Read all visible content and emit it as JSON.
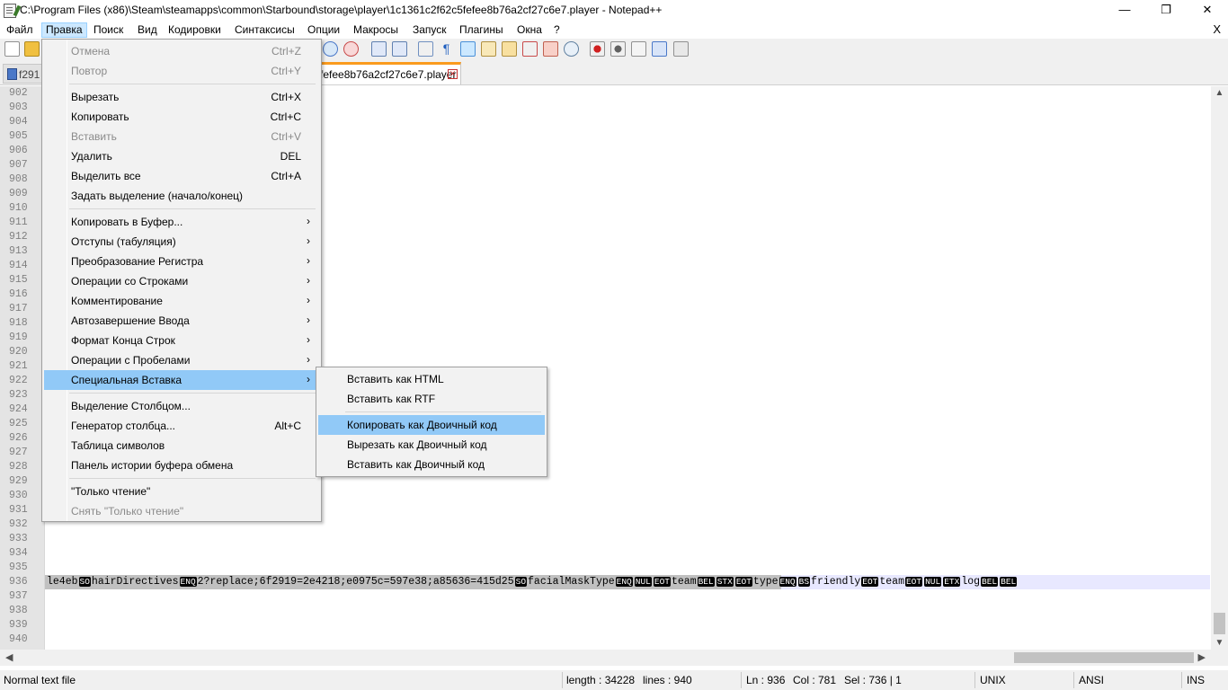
{
  "window": {
    "title": "C:\\Program Files (x86)\\Steam\\steamapps\\common\\Starbound\\storage\\player\\1c1361c2f62c5fefee8b76a2cf27c6e7.player - Notepad++",
    "minimize": "—",
    "maximize": "❐",
    "close": "✕"
  },
  "menubar": {
    "items": [
      "Файл",
      "Правка",
      "Поиск",
      "Вид",
      "Кодировки",
      "Синтаксисы",
      "Опции",
      "Макросы",
      "Запуск",
      "Плагины",
      "Окна",
      "?"
    ],
    "active": "Правка",
    "close_glyph": "X"
  },
  "tabs": [
    {
      "label": "f291",
      "active": false
    },
    {
      "label": "fefee8b76a2cf27c6e7.player",
      "active": true,
      "close_glyph": "✕"
    }
  ],
  "line_numbers": [
    "902",
    "903",
    "904",
    "905",
    "906",
    "907",
    "908",
    "909",
    "910",
    "911",
    "912",
    "913",
    "914",
    "915",
    "916",
    "917",
    "918",
    "919",
    "920",
    "921",
    "922",
    "923",
    "924",
    "925",
    "926",
    "927",
    "928",
    "929",
    "930",
    "931",
    "932",
    "933",
    "934",
    "935",
    "936",
    "937",
    "938",
    "939",
    "940"
  ],
  "code_line": {
    "line_number": "936",
    "tokens": [
      {
        "t": "text",
        "v": "le4eb"
      },
      {
        "t": "ctl",
        "v": "SO"
      },
      {
        "t": "text",
        "v": "hairDirectives"
      },
      {
        "t": "ctl",
        "v": "ENQ"
      },
      {
        "t": "text",
        "v": "2?replace;6f2919=2e4218;e0975c=597e38;a85636=415d25"
      },
      {
        "t": "ctl",
        "v": "SO"
      },
      {
        "t": "text",
        "v": "facialMaskType"
      },
      {
        "t": "ctl",
        "v": "ENQ"
      },
      {
        "t": "ctl",
        "v": "NUL"
      },
      {
        "t": "ctl",
        "v": "EOT"
      },
      {
        "t": "text",
        "v": "team"
      },
      {
        "t": "ctl",
        "v": "BEL"
      },
      {
        "t": "ctl",
        "v": "STX"
      },
      {
        "t": "ctl",
        "v": "EOT"
      },
      {
        "t": "text",
        "v": "type"
      },
      {
        "t": "ctl",
        "v": "ENQ"
      },
      {
        "t": "ctl",
        "v": "BS"
      },
      {
        "t": "text",
        "v": "friendly"
      },
      {
        "t": "ctl",
        "v": "EOT"
      },
      {
        "t": "text",
        "v": "team"
      },
      {
        "t": "ctl",
        "v": "EOT"
      },
      {
        "t": "ctl",
        "v": "NUL"
      },
      {
        "t": "ctl",
        "v": "ETX"
      },
      {
        "t": "text",
        "v": "log"
      },
      {
        "t": "ctl",
        "v": "BEL"
      },
      {
        "t": "ctl",
        "v": "BEL"
      }
    ]
  },
  "edit_menu": {
    "items": [
      {
        "label": "Отмена",
        "shortcut": "Ctrl+Z",
        "disabled": true
      },
      {
        "label": "Повтор",
        "shortcut": "Ctrl+Y",
        "disabled": true
      },
      {
        "sep": true
      },
      {
        "label": "Вырезать",
        "shortcut": "Ctrl+X"
      },
      {
        "label": "Копировать",
        "shortcut": "Ctrl+C"
      },
      {
        "label": "Вставить",
        "shortcut": "Ctrl+V",
        "disabled": true
      },
      {
        "label": "Удалить",
        "shortcut": "DEL"
      },
      {
        "label": "Выделить все",
        "shortcut": "Ctrl+A"
      },
      {
        "label": "Задать выделение (начало/конец)",
        "shortcut": ""
      },
      {
        "sep": true
      },
      {
        "label": "Копировать в Буфер...",
        "submenu": true
      },
      {
        "label": "Отступы (табуляция)",
        "submenu": true
      },
      {
        "label": "Преобразование Регистра",
        "submenu": true
      },
      {
        "label": "Операции со Строками",
        "submenu": true
      },
      {
        "label": "Комментирование",
        "submenu": true
      },
      {
        "label": "Автозавершение Ввода",
        "submenu": true
      },
      {
        "label": "Формат Конца Строк",
        "submenu": true
      },
      {
        "label": "Операции с Пробелами",
        "submenu": true
      },
      {
        "label": "Специальная Вставка",
        "submenu": true,
        "highlighted": true
      },
      {
        "sep": true
      },
      {
        "label": "Выделение Столбцом...",
        "shortcut": ""
      },
      {
        "label": "Генератор столбца...",
        "shortcut": "Alt+C"
      },
      {
        "label": "Таблица символов",
        "shortcut": ""
      },
      {
        "label": "Панель истории буфера обмена",
        "shortcut": ""
      },
      {
        "sep": true
      },
      {
        "label": "\"Только чтение\"",
        "shortcut": ""
      },
      {
        "label": "Снять \"Только чтение\"",
        "shortcut": "",
        "disabled": true
      }
    ],
    "submenu_arrow": "›"
  },
  "paste_special_submenu": {
    "items": [
      {
        "label": "Вставить как HTML"
      },
      {
        "label": "Вставить как RTF"
      },
      {
        "sep": true
      },
      {
        "label": "Копировать как Двоичный код",
        "highlighted": true
      },
      {
        "label": "Вырезать как Двоичный код"
      },
      {
        "label": "Вставить как Двоичный код"
      }
    ]
  },
  "statusbar": {
    "file_type": "Normal text file",
    "length": "length : 34228",
    "lines": "lines : 940",
    "ln": "Ln : 936",
    "col": "Col : 781",
    "sel": "Sel : 736 | 1",
    "eol": "UNIX",
    "encoding": "ANSI",
    "mode": "INS"
  },
  "colors": {
    "menu_highlight": "#91c9f7",
    "menubar_active": "#cce8ff",
    "tab_accent": "#fa9b1e",
    "gutter": "#e4e4e4",
    "current_line": "#e8e8ff"
  }
}
